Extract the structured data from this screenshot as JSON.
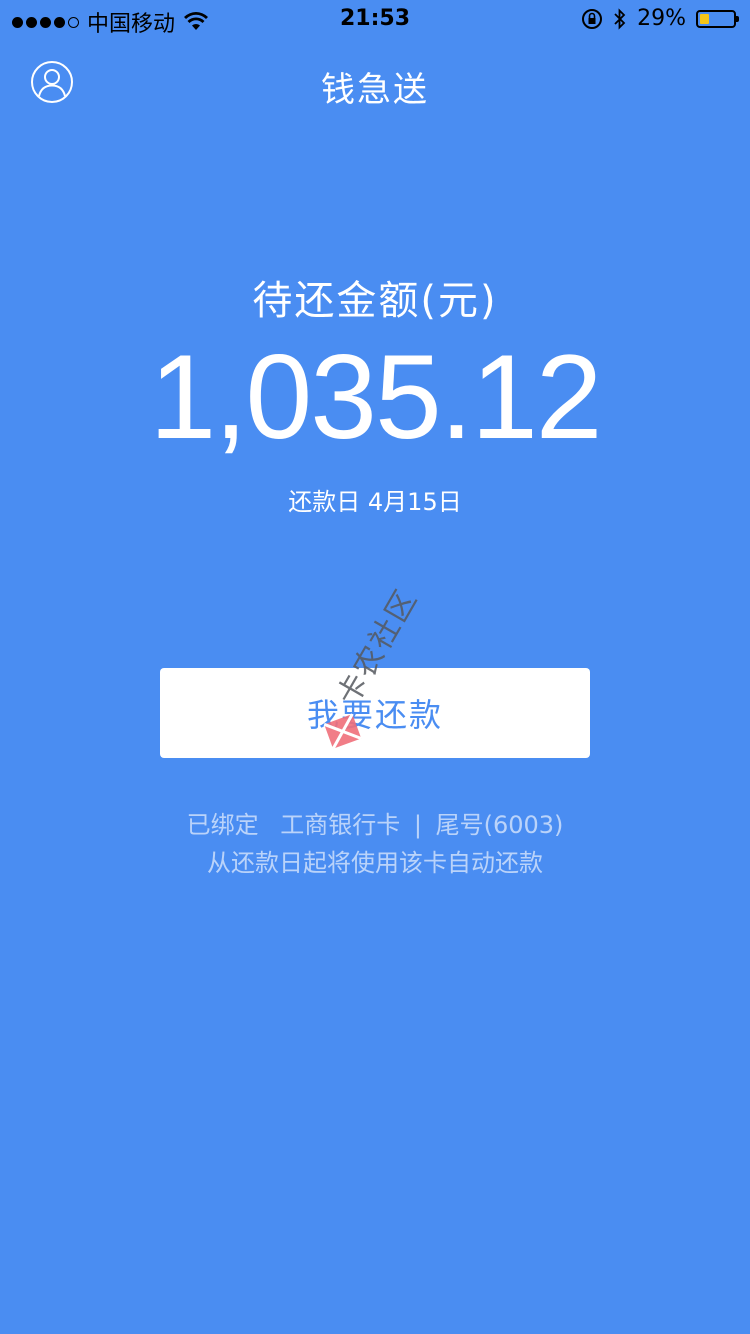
{
  "status_bar": {
    "carrier": "中国移动",
    "time": "21:53",
    "battery_percent_label": "29%",
    "battery_level": 0.29,
    "signal_bars_filled": 4,
    "signal_bars_total": 5
  },
  "nav": {
    "title": "钱急送",
    "profile_icon": "user-circle-icon"
  },
  "summary": {
    "amount_label": "待还金额(元)",
    "amount": "1,035.12",
    "due_date_text": "还款日 4月15日"
  },
  "repay_button": {
    "label": "我要还款"
  },
  "card_info": {
    "bound_prefix": "已绑定",
    "bank_name": "工商银行卡",
    "separator": "|",
    "tail_number": "尾号(6003)",
    "auto_repay_note": "从还款日起将使用该卡自动还款"
  },
  "watermark": {
    "text": "卡农社区"
  },
  "colors": {
    "background": "#4a8df2",
    "button_text": "#4a8df2",
    "battery_fill": "#f5c518"
  }
}
